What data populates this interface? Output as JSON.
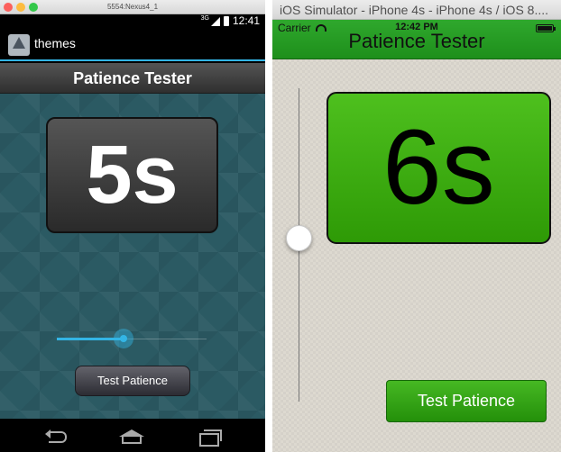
{
  "android": {
    "window_title": "5554:Nexus4_1",
    "status": {
      "network": "3G",
      "time": "12:41"
    },
    "action_bar": {
      "app_title": "themes",
      "logo_icon": "app-logo-icon"
    },
    "header_title": "Patience Tester",
    "timer_display": "5s",
    "slider": {
      "value_fraction": 0.45
    },
    "button_label": "Test Patience",
    "nav_icons": [
      "back-icon",
      "home-icon",
      "recent-apps-icon"
    ],
    "colors": {
      "accent": "#33b5e5",
      "background": "#2b5a63"
    }
  },
  "ios": {
    "window_title": "iOS Simulator - iPhone 4s - iPhone 4s / iOS 8....",
    "status": {
      "carrier": "Carrier",
      "time": "12:42 PM"
    },
    "nav_title": "Patience Tester",
    "timer_display": "6s",
    "slider": {
      "value_fraction": 0.55
    },
    "button_label": "Test Patience",
    "colors": {
      "accent": "#2e9a06",
      "background": "#ddd9d0"
    }
  }
}
